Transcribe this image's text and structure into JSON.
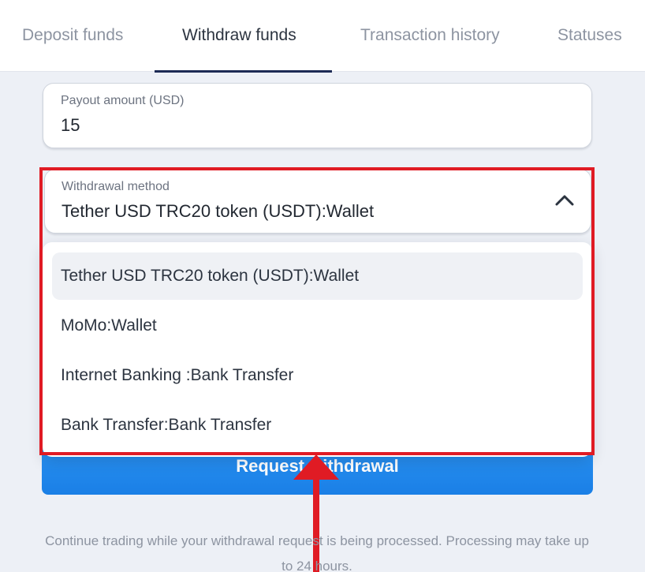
{
  "tabs": [
    {
      "label": "Deposit funds",
      "active": false
    },
    {
      "label": "Withdraw funds",
      "active": true
    },
    {
      "label": "Transaction history",
      "active": false
    },
    {
      "label": "Statuses",
      "active": false
    }
  ],
  "payout": {
    "label": "Payout amount (USD)",
    "value": "15"
  },
  "withdrawal_method": {
    "label": "Withdrawal method",
    "selected": "Tether USD TRC20 token (USDT):Wallet",
    "expanded": true,
    "icon": "chevron-up-icon",
    "options": [
      "Tether USD TRC20 token (USDT):Wallet",
      "MoMo:Wallet",
      "Internet Banking :Bank Transfer",
      "Bank Transfer:Bank Transfer"
    ]
  },
  "request_button": {
    "label": "Request withdrawal"
  },
  "info_note": "Continue trading while your withdrawal request is being processed.  Processing may take up to 24 hours.",
  "colors": {
    "highlight": "#e01b24",
    "accent": "#1a7fe6",
    "active_tab_underline": "#1c2a55"
  }
}
